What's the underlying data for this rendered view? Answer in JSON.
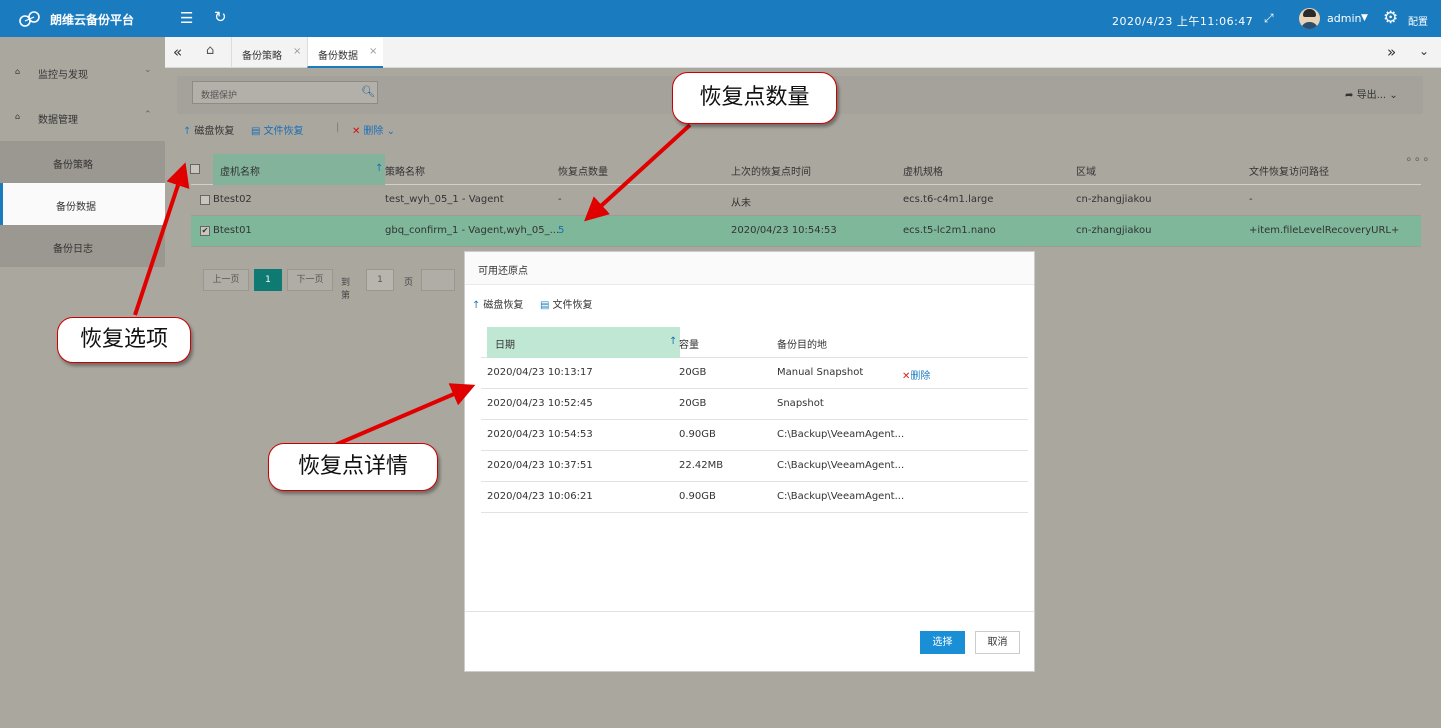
{
  "topbar": {
    "brand": "朗维云备份平台",
    "datetime": "2020/4/23 上午11:06:47",
    "user": "admin",
    "config": "配置",
    "icons": [
      "logo-icon",
      "menu-icon",
      "refresh-icon",
      "fullscreen-icon",
      "gear-icon"
    ]
  },
  "sidebar": {
    "groups": [
      {
        "label": "监控与发现"
      },
      {
        "label": "数据管理"
      }
    ],
    "items": [
      {
        "label": "备份策略"
      },
      {
        "label": "备份数据"
      },
      {
        "label": "备份日志"
      }
    ]
  },
  "tabs": [
    {
      "label": "备份策略"
    },
    {
      "label": "备份数据"
    }
  ],
  "toolbar": {
    "search_placeholder": "数据保护",
    "export": "导出...",
    "disk_restore": "磁盘恢复",
    "file_restore": "文件恢复",
    "delete": "删除"
  },
  "table": {
    "columns": [
      "虚机名称",
      "策略名称",
      "恢复点数量",
      "上次的恢复点时间",
      "虚机规格",
      "区域",
      "文件恢复访问路径"
    ],
    "rows": [
      {
        "name": "Btest02",
        "policy": "test_wyh_05_1 - Vagent",
        "count": "-",
        "last": "从未",
        "spec": "ecs.t6-c4m1.large",
        "region": "cn-zhangjiakou",
        "path": "-",
        "selected": false
      },
      {
        "name": "Btest01",
        "policy": "gbq_confirm_1 - Vagent,wyh_05_...",
        "count": "5",
        "last": "2020/04/23 10:54:53",
        "spec": "ecs.t5-lc2m1.nano",
        "region": "cn-zhangjiakou",
        "path": "+item.fileLevelRecoveryURL+",
        "selected": true
      }
    ]
  },
  "pager": {
    "prev": "上一页",
    "page": "1",
    "next": "下一页",
    "goto": "到第",
    "input": "1",
    "unit": "页"
  },
  "modal": {
    "title": "可用还原点",
    "disk_restore": "磁盘恢复",
    "file_restore": "文件恢复",
    "columns": [
      "日期",
      "容量",
      "备份目的地"
    ],
    "rows": [
      {
        "date": "2020/04/23 10:13:17",
        "size": "20GB",
        "dest": "Manual Snapshot",
        "delete": "删除"
      },
      {
        "date": "2020/04/23 10:52:45",
        "size": "20GB",
        "dest": "Snapshot"
      },
      {
        "date": "2020/04/23 10:54:53",
        "size": "0.90GB",
        "dest": "C:\\Backup\\VeeamAgent..."
      },
      {
        "date": "2020/04/23 10:37:51",
        "size": "22.42MB",
        "dest": "C:\\Backup\\VeeamAgent..."
      },
      {
        "date": "2020/04/23 10:06:21",
        "size": "0.90GB",
        "dest": "C:\\Backup\\VeeamAgent..."
      }
    ],
    "select": "选择",
    "cancel": "取消"
  },
  "callouts": {
    "restore_count": "恢复点数量",
    "restore_options": "恢复选项",
    "restore_details": "恢复点详情"
  },
  "colors": {
    "topbar": "#1b7bbf",
    "accent": "#1b8fd6",
    "annotation": "#e00000"
  }
}
